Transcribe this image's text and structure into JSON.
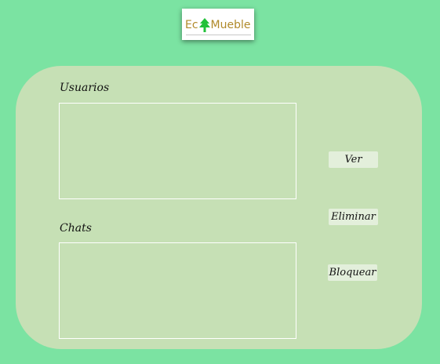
{
  "logo": {
    "text_left": "Ec",
    "text_right": "Mueble"
  },
  "sections": {
    "usuarios_label": "Usuarios",
    "chats_label": "Chats"
  },
  "buttons": {
    "ver": "Ver",
    "eliminar": "Eliminar",
    "bloquear": "Bloquear"
  },
  "colors": {
    "background": "#7be3a2",
    "panel": "#c6e0b5",
    "button": "#e3efdb",
    "logo_text": "#b08a2a",
    "logo_tree": "#22c13a"
  }
}
